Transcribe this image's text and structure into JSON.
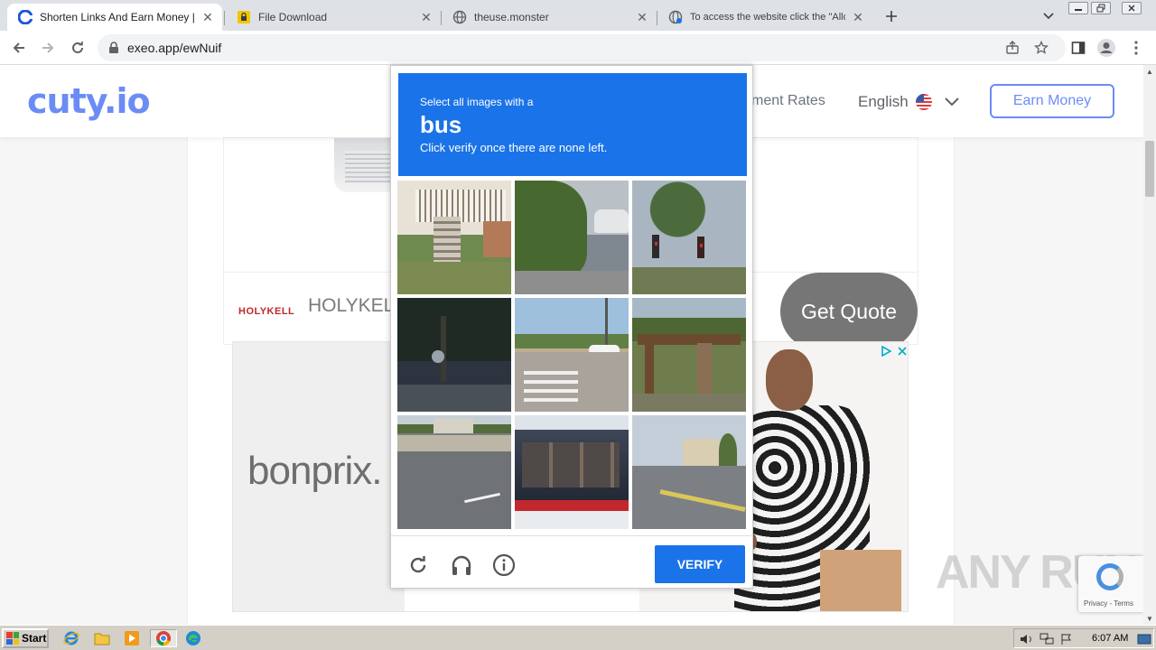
{
  "browser": {
    "tabs": [
      {
        "title": "Shorten Links And Earn Money | cuty",
        "favicon": "cuty-icon",
        "active": true
      },
      {
        "title": "File Download",
        "favicon": "lock-icon",
        "active": false
      },
      {
        "title": "theuse.monster",
        "favicon": "globe-icon",
        "active": false
      },
      {
        "title": "To access the website click the \"Allow\"",
        "favicon": "globe-loading-icon",
        "active": false
      }
    ],
    "url": "exeo.app/ewNuif"
  },
  "site": {
    "logo": "cuty.io",
    "nav_link": "ment Rates",
    "language": "English",
    "earn_button": "Earn Money"
  },
  "ads": {
    "holykell_logo": "HOLYKELL",
    "holykell_name": "HOLYKELL",
    "quote_button": "Get Quote",
    "bonprix": "bonprix."
  },
  "captcha": {
    "instruction_pre": "Select all images with a",
    "target_object": "bus",
    "instruction_post": "Click verify once there are none left.",
    "verify_label": "VERIFY",
    "tiles": [
      "house-stairs",
      "road-trees-car",
      "traffic-lights",
      "dark-street-motorbike",
      "crosswalk-intersection",
      "wooden-gate",
      "highway-trucks",
      "city-bus",
      "road-building"
    ]
  },
  "recaptcha": {
    "terms": "Privacy - Terms"
  },
  "watermark": "ANY RUN",
  "taskbar": {
    "start_label": "Start",
    "clock": "6:07 AM"
  }
}
